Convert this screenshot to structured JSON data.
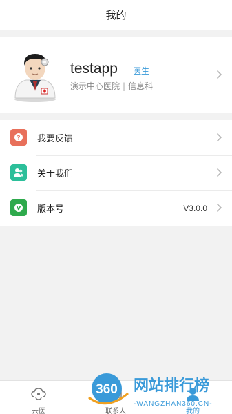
{
  "header": {
    "title": "我的"
  },
  "profile": {
    "name": "testapp",
    "role": "医生",
    "hospital": "演示中心医院",
    "separator": "|",
    "department": "信息科"
  },
  "menu": {
    "items": [
      {
        "label": "我要反馈",
        "icon": "feedback-icon",
        "icon_glyph": "?",
        "color": "#e8705b"
      },
      {
        "label": "关于我们",
        "icon": "about-us-icon",
        "icon_glyph": "",
        "color": "#2cbf9a"
      },
      {
        "label": "版本号",
        "icon": "version-icon",
        "icon_glyph": "v",
        "color": "#2eaa4c",
        "value": "V3.0.0"
      }
    ]
  },
  "tabs": [
    {
      "label": "云医",
      "icon": "cloud-doctor-icon",
      "active": false
    },
    {
      "label": "联系人",
      "icon": "contacts-icon",
      "active": false
    },
    {
      "label": "我的",
      "icon": "profile-icon",
      "active": true
    }
  ],
  "watermark": {
    "badge": "360",
    "title": "网站排行榜",
    "subtitle": "-WANGZHAN360.CN-"
  },
  "colors": {
    "accent": "#3a9ad9",
    "background": "#f2f2f2"
  }
}
